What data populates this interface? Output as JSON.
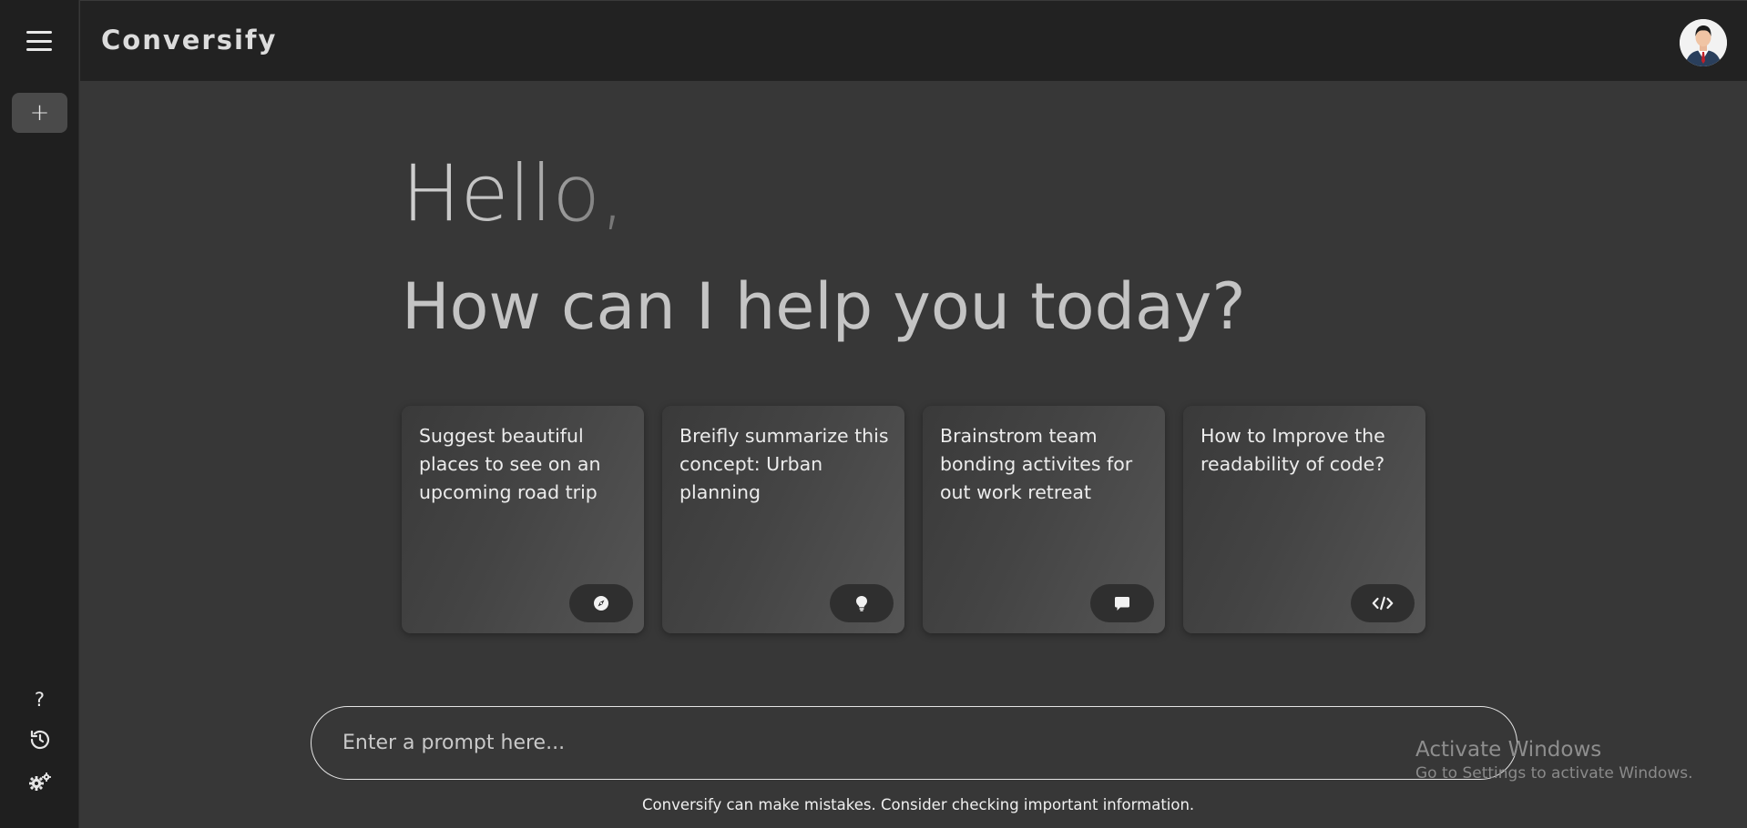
{
  "app": {
    "brand": "Conversify"
  },
  "sidebar": {
    "new_chat_label": "+",
    "help_label": "?"
  },
  "hero": {
    "greeting": "Hello,",
    "subtitle": "How can I help you today?"
  },
  "cards": [
    {
      "text": "Suggest beautiful places to see on an upcoming road trip",
      "icon": "compass-icon"
    },
    {
      "text": "Breifly summarize this concept: Urban planning",
      "icon": "lightbulb-icon"
    },
    {
      "text": "Brainstrom team bonding activites for out work retreat",
      "icon": "chat-bubble-icon"
    },
    {
      "text": "How to Improve the readability of code?",
      "icon": "code-icon"
    }
  ],
  "prompt": {
    "placeholder": "Enter a prompt here..."
  },
  "footer": {
    "disclaimer": "Conversify can make mistakes. Consider checking important information."
  },
  "watermark": {
    "title": "Activate Windows",
    "subtitle": "Go to Settings to activate Windows."
  },
  "colors": {
    "background": "#373737",
    "sidebar": "#1f1f1f",
    "topbar": "#222222",
    "card_icon_bg": "#2f2f2f"
  }
}
